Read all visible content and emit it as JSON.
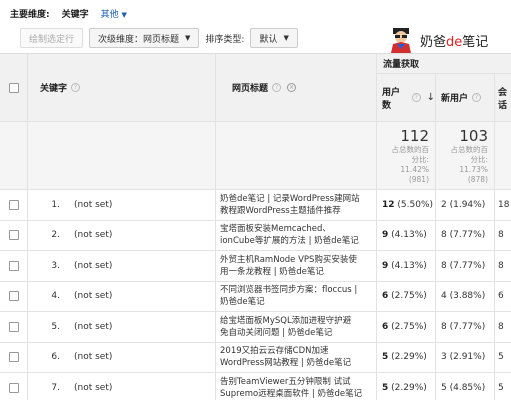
{
  "dimbar": {
    "primary_label": "主要维度:",
    "active": "关键字",
    "other": "其他"
  },
  "toolbar": {
    "plot_rows": "绘制选定行",
    "secondary_dim": "次级维度：网页标题",
    "sort_type_label": "排序类型:",
    "sort_value": "默认"
  },
  "watermark": {
    "text_a": "奶爸",
    "text_b": "de",
    "text_c": "笔记"
  },
  "table": {
    "group_header": "流量获取",
    "col_keyword": "关键字",
    "col_page_title": "网页标题",
    "col_users": "用户数",
    "col_new_users": "新用户",
    "col_sessions": "会话",
    "totals": {
      "users_big": "112",
      "users_l1": "占总数的百",
      "users_l2": "分比:",
      "users_l3": "11.42%",
      "users_l4": "(981)",
      "new_big": "103",
      "new_l1": "占总数的百",
      "new_l2": "分比:",
      "new_l3": "11.73%",
      "new_l4": "(878)"
    },
    "rows": [
      {
        "idx": "1.",
        "kw": "(not set)",
        "t1": "奶爸de笔记 | 记录WordPress建网站",
        "t2": "教程跟WordPress主题插件推荐",
        "u": "12",
        "up": "(5.50%)",
        "n": "2",
        "np": "(1.94%)",
        "s": "18"
      },
      {
        "idx": "2.",
        "kw": "(not set)",
        "t1": "宝塔面板安装Memcached、",
        "t2": "ionCube等扩展的方法 | 奶爸de笔记",
        "u": "9",
        "up": "(4.13%)",
        "n": "8",
        "np": "(7.77%)",
        "s": "8"
      },
      {
        "idx": "3.",
        "kw": "(not set)",
        "t1": "外贸主机RamNode VPS购买安装使",
        "t2": "用一条龙教程 | 奶爸de笔记",
        "u": "9",
        "up": "(4.13%)",
        "n": "8",
        "np": "(7.77%)",
        "s": "8"
      },
      {
        "idx": "4.",
        "kw": "(not set)",
        "t1": "不同浏览器书签同步方案：floccus |",
        "t2": "奶爸de笔记",
        "u": "6",
        "up": "(2.75%)",
        "n": "4",
        "np": "(3.88%)",
        "s": "6"
      },
      {
        "idx": "5.",
        "kw": "(not set)",
        "t1": "给宝塔面板MySQL添加进程守护避",
        "t2": "免自动关闭问题 | 奶爸de笔记",
        "u": "6",
        "up": "(2.75%)",
        "n": "8",
        "np": "(7.77%)",
        "s": "8"
      },
      {
        "idx": "6.",
        "kw": "(not set)",
        "t1": "2019又拍云云存储CDN加速",
        "t2": "WordPress网站教程 | 奶爸de笔记",
        "u": "5",
        "up": "(2.29%)",
        "n": "3",
        "np": "(2.91%)",
        "s": "5"
      },
      {
        "idx": "7.",
        "kw": "(not set)",
        "t1": "告别TeamViewer五分钟限制 试试",
        "t2": "Supremo远程桌面软件 | 奶爸de笔记",
        "u": "5",
        "up": "(2.29%)",
        "n": "5",
        "np": "(4.85%)",
        "s": "5"
      }
    ]
  }
}
